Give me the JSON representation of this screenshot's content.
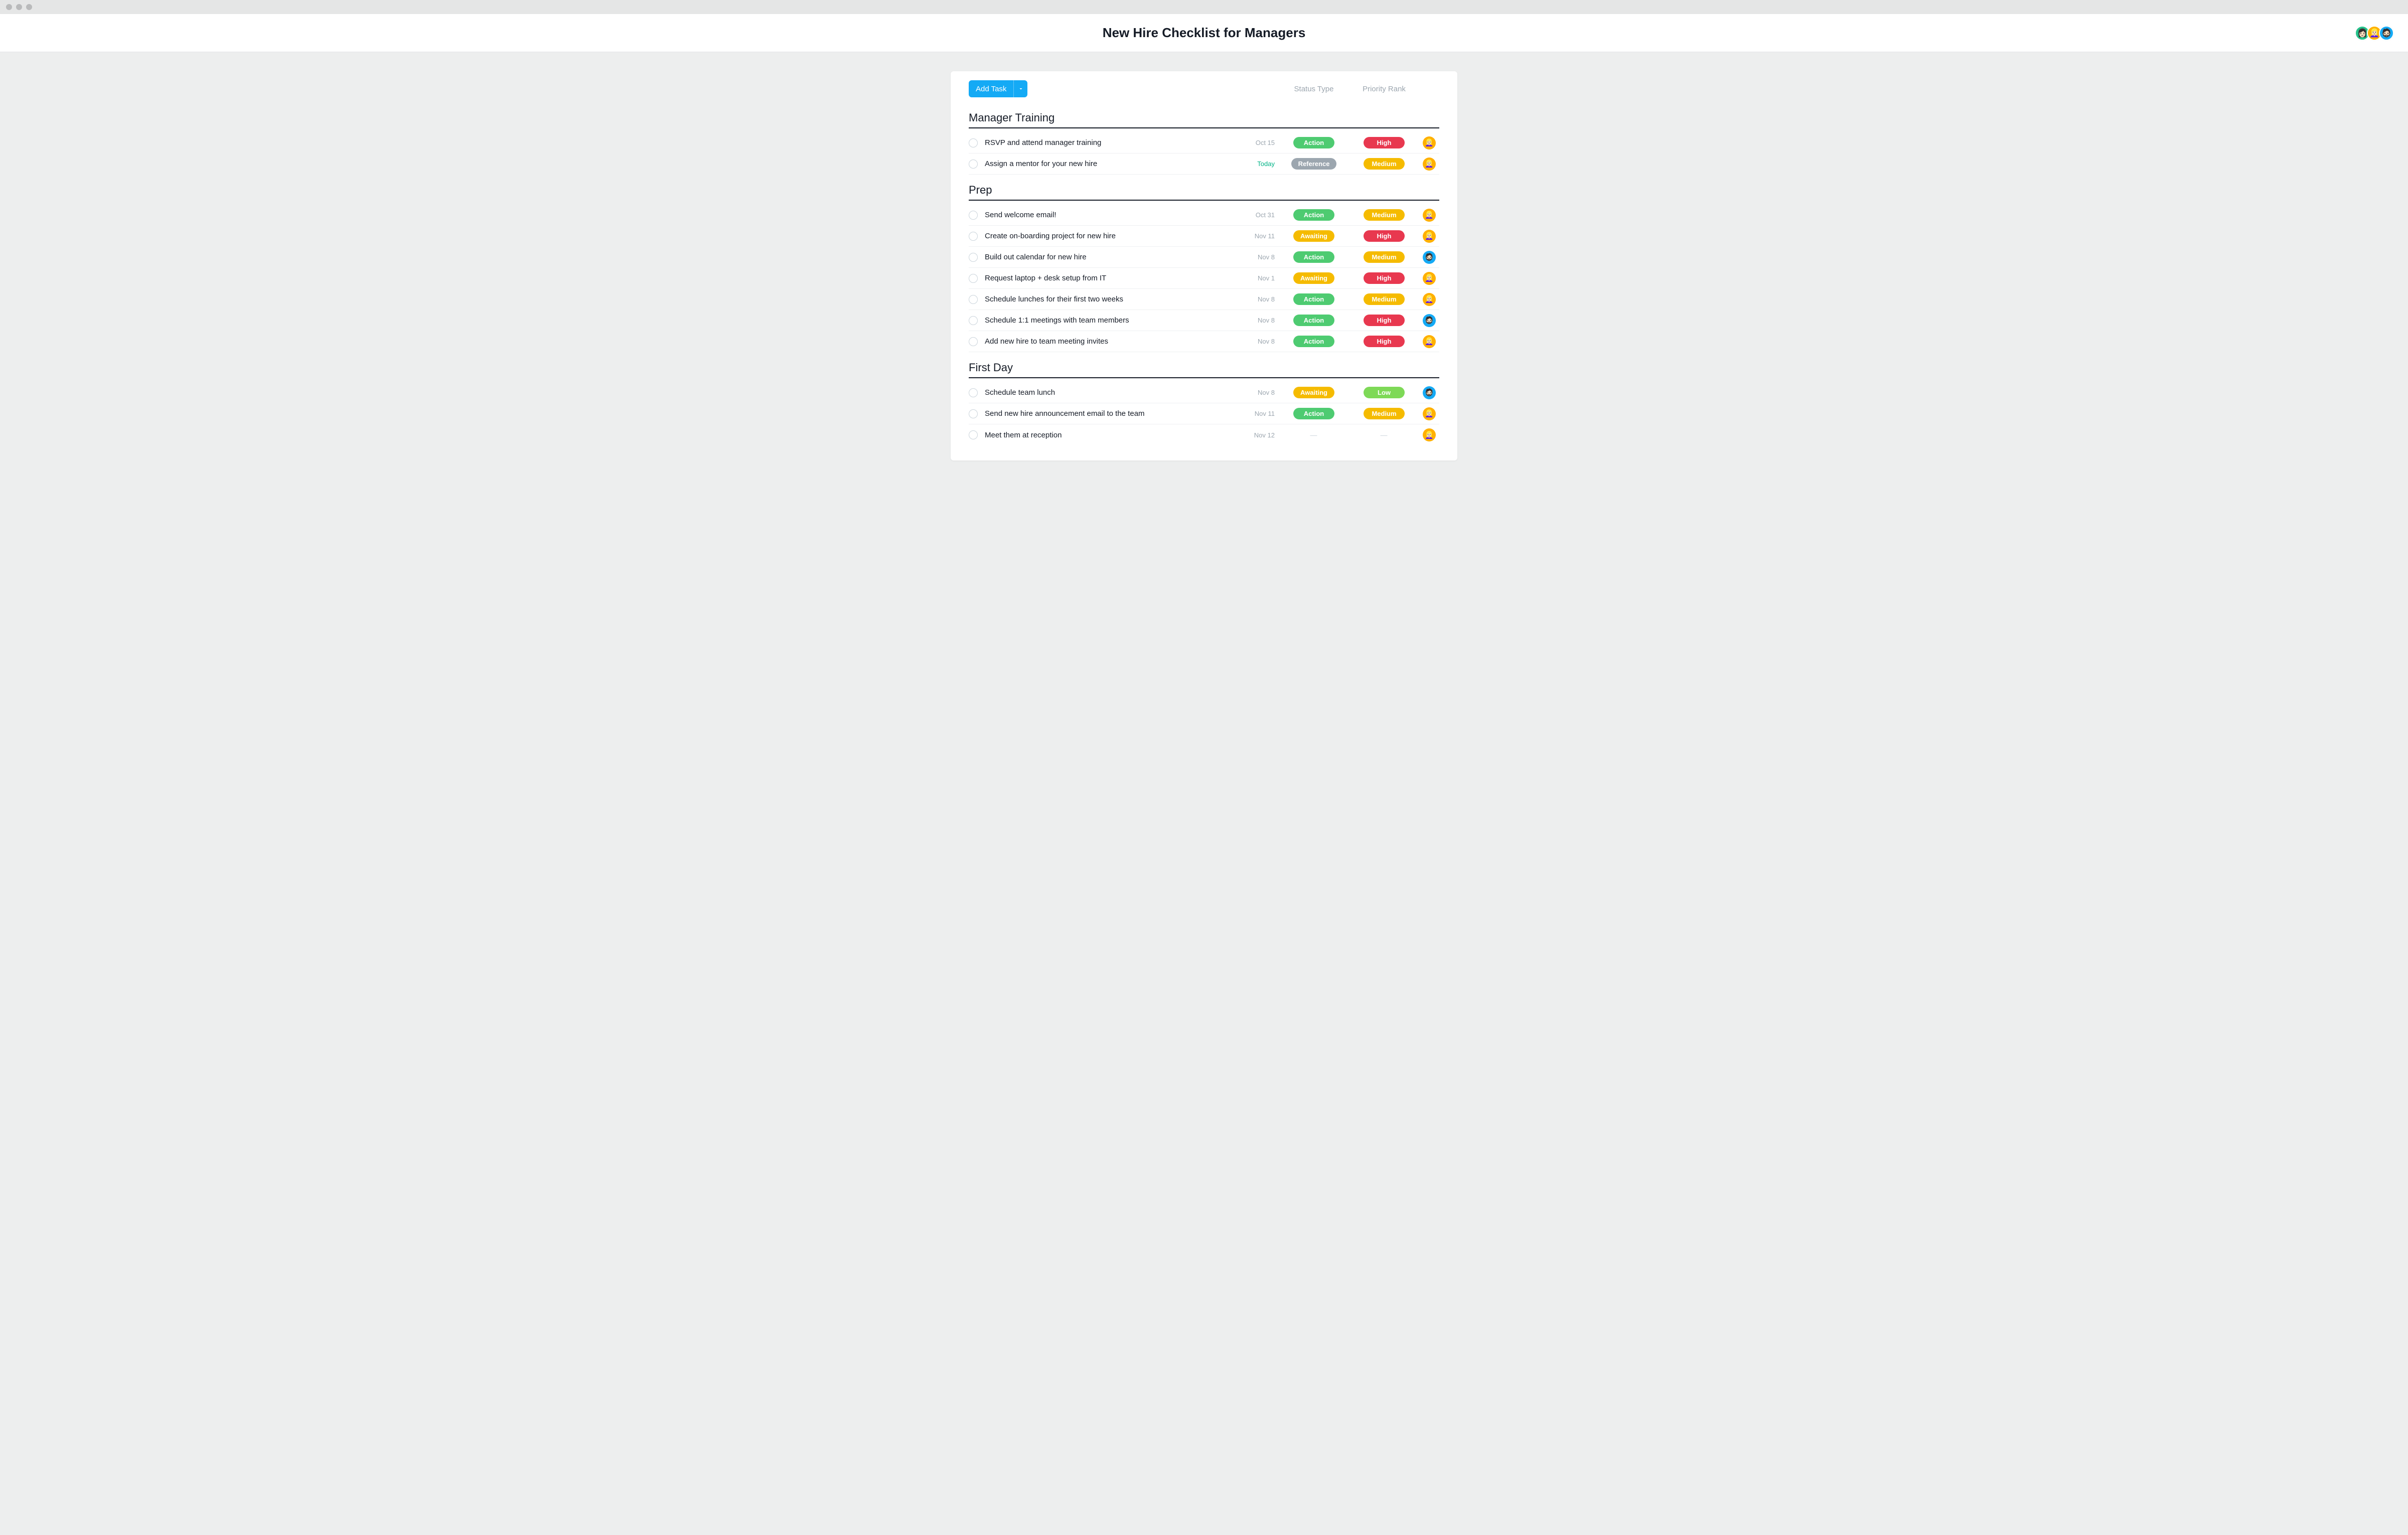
{
  "header": {
    "title": "New Hire Checklist for Managers"
  },
  "header_avatars": [
    {
      "bg": "#25c28b",
      "emoji": "👩🏻"
    },
    {
      "bg": "#ffb000",
      "emoji": "👱🏻‍♀️"
    },
    {
      "bg": "#14aaf5",
      "emoji": "🧔🏻"
    }
  ],
  "toolbar": {
    "add_task_label": "Add Task"
  },
  "columns": {
    "status_label": "Status Type",
    "priority_label": "Priority Rank"
  },
  "colors": {
    "status": {
      "Action": "#4ecb71",
      "Awaiting": "#f5bb00",
      "Reference": "#9ca6af"
    },
    "priority": {
      "High": "#e8384f",
      "Medium": "#f5bb00",
      "Low": "#7ed957"
    },
    "assignee": {
      "amber": "#ffb000",
      "blue": "#14aaf5"
    }
  },
  "assignee_emoji": {
    "amber": "👱🏻‍♀️",
    "blue": "🧔🏻"
  },
  "sections": [
    {
      "title": "Manager Training",
      "tasks": [
        {
          "name": "RSVP and attend manager training",
          "date": "Oct 15",
          "today": false,
          "status": "Action",
          "priority": "High",
          "assignee": "amber"
        },
        {
          "name": "Assign a mentor for your new hire",
          "date": "Today",
          "today": true,
          "status": "Reference",
          "priority": "Medium",
          "assignee": "amber"
        }
      ]
    },
    {
      "title": "Prep",
      "tasks": [
        {
          "name": "Send welcome email!",
          "date": "Oct 31",
          "today": false,
          "status": "Action",
          "priority": "Medium",
          "assignee": "amber"
        },
        {
          "name": "Create on-boarding project for new hire",
          "date": "Nov 11",
          "today": false,
          "status": "Awaiting",
          "priority": "High",
          "assignee": "amber"
        },
        {
          "name": "Build out calendar for new hire",
          "date": "Nov 8",
          "today": false,
          "status": "Action",
          "priority": "Medium",
          "assignee": "blue"
        },
        {
          "name": "Request laptop + desk setup from IT",
          "date": "Nov 1",
          "today": false,
          "status": "Awaiting",
          "priority": "High",
          "assignee": "amber"
        },
        {
          "name": "Schedule lunches for their first two weeks",
          "date": "Nov 8",
          "today": false,
          "status": "Action",
          "priority": "Medium",
          "assignee": "amber"
        },
        {
          "name": "Schedule 1:1 meetings with team members",
          "date": "Nov 8",
          "today": false,
          "status": "Action",
          "priority": "High",
          "assignee": "blue"
        },
        {
          "name": "Add new hire to team meeting invites",
          "date": "Nov 8",
          "today": false,
          "status": "Action",
          "priority": "High",
          "assignee": "amber"
        }
      ]
    },
    {
      "title": "First Day",
      "tasks": [
        {
          "name": "Schedule team lunch",
          "date": "Nov 8",
          "today": false,
          "status": "Awaiting",
          "priority": "Low",
          "assignee": "blue"
        },
        {
          "name": "Send new hire announcement email to the team",
          "date": "Nov 11",
          "today": false,
          "status": "Action",
          "priority": "Medium",
          "assignee": "amber"
        },
        {
          "name": "Meet them at reception",
          "date": "Nov 12",
          "today": false,
          "status": null,
          "priority": null,
          "assignee": "amber"
        }
      ]
    }
  ]
}
